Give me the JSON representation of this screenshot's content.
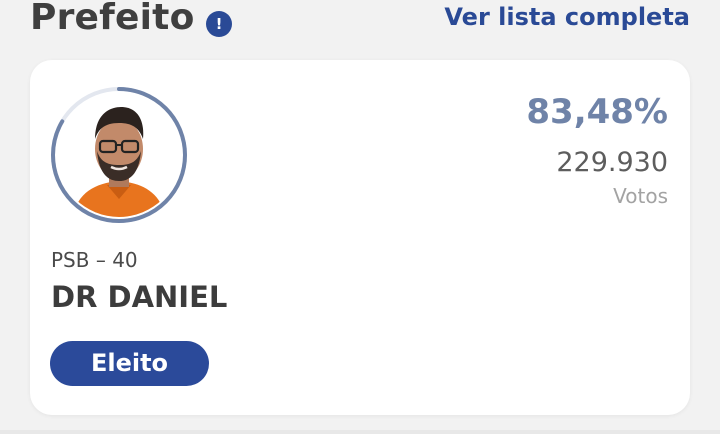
{
  "header": {
    "title": "Prefeito",
    "info_icon": "info-icon",
    "info_glyph": "!",
    "see_all_label": "Ver lista completa"
  },
  "candidate": {
    "percent": "83,48%",
    "vote_share": 0.8348,
    "votes": "229.930",
    "votes_label": "Votos",
    "party": "PSB – 40",
    "name": "DR DANIEL",
    "status": "Eleito"
  },
  "colors": {
    "accent": "#2a4a96",
    "ring": "#6f83a8",
    "percent": "#6f83a8",
    "background": "#f2f2f2",
    "card": "#ffffff"
  }
}
